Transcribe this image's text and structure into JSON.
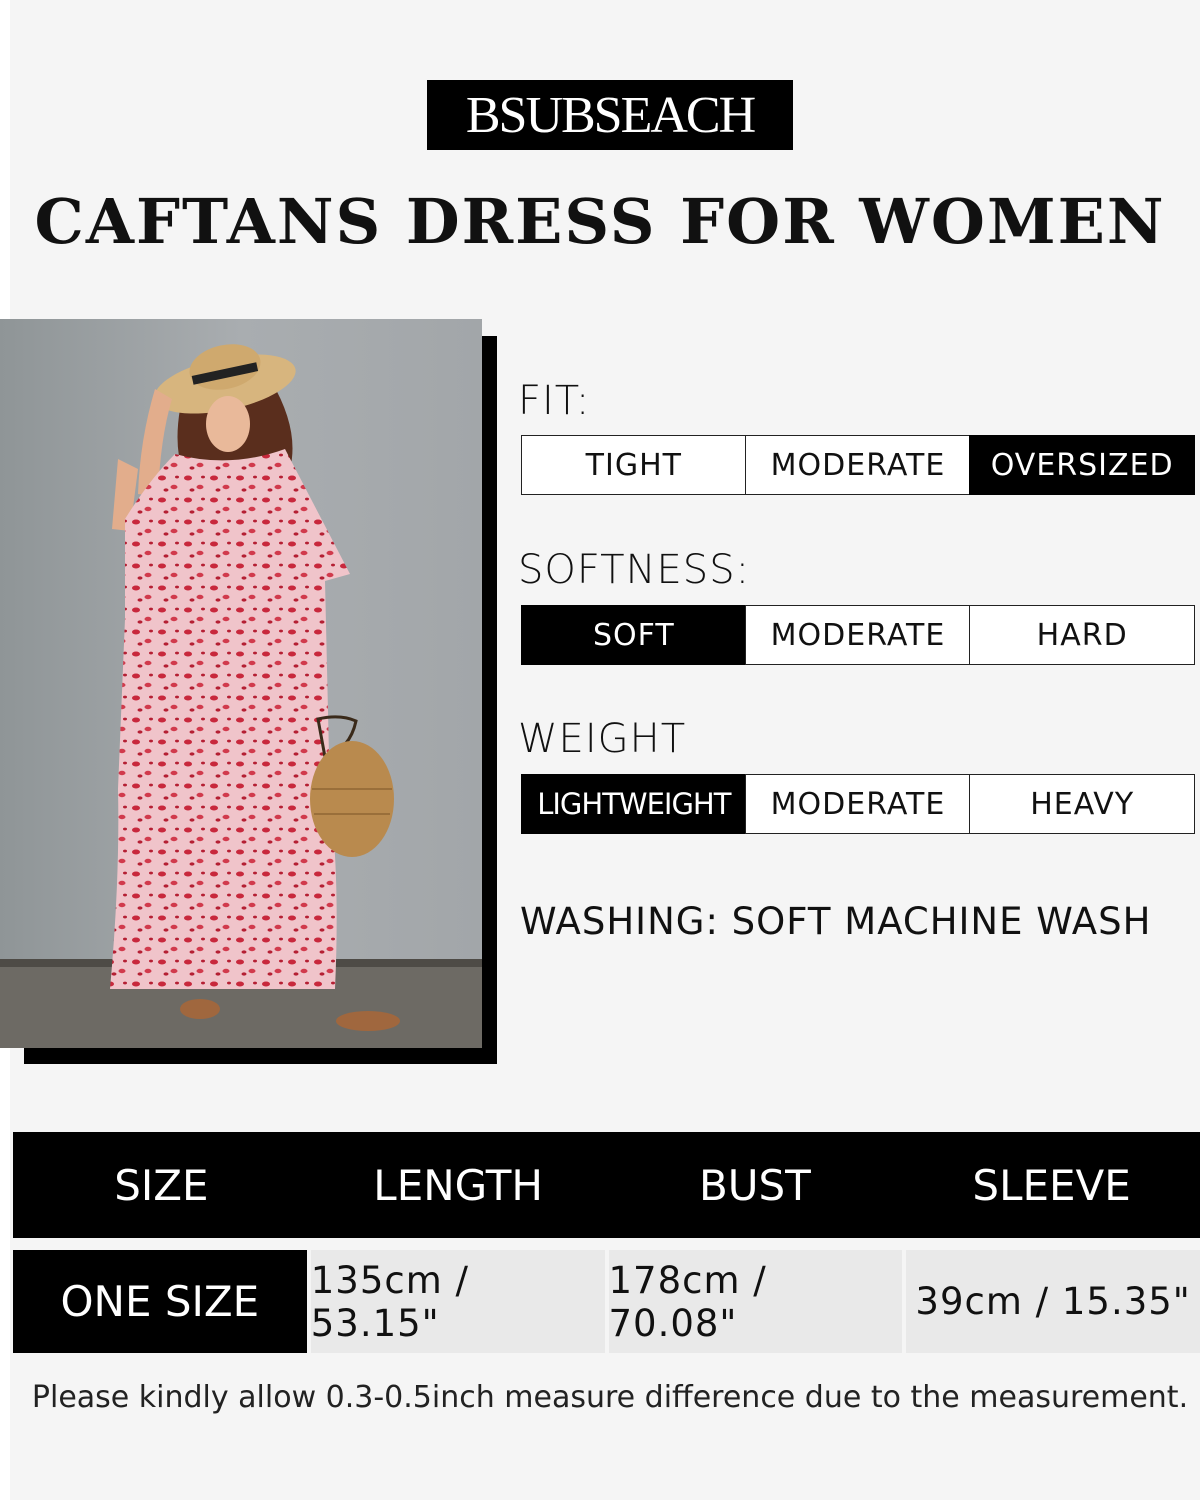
{
  "brand": "BSUBSEACH",
  "title": "CAFTANS DRESS FOR WOMEN",
  "ratings": [
    {
      "label": "FIT:",
      "options": [
        "TIGHT",
        "MODERATE",
        "OVERSIZED"
      ],
      "selected": "OVERSIZED"
    },
    {
      "label": "SOFTNESS:",
      "options": [
        "SOFT",
        "MODERATE",
        "HARD"
      ],
      "selected": "SOFT"
    },
    {
      "label": "WEIGHT",
      "options": [
        "LIGHTWEIGHT",
        "MODERATE",
        "HEAVY"
      ],
      "selected": "LIGHTWEIGHT"
    }
  ],
  "washing": "WASHING: SOFT MACHINE WASH",
  "size_table": {
    "headers": [
      "SIZE",
      "LENGTH",
      "BUST",
      "SLEEVE"
    ],
    "row": [
      "ONE SIZE",
      "135cm / 53.15\"",
      "178cm / 70.08\"",
      "39cm / 15.35\""
    ]
  },
  "note": "Please kindly allow 0.3-0.5inch measure difference due to the measurement.",
  "colors": {
    "selected_bg": "#000000",
    "dress_pink": "#e8a3ad",
    "dress_red": "#c8283c"
  }
}
